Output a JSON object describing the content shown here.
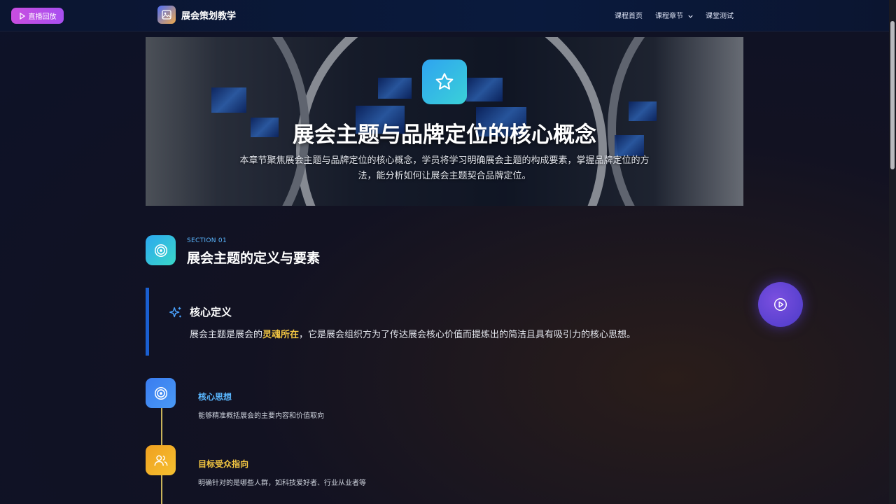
{
  "topbar": {
    "live_label": "直播回放",
    "brand_title": "展会策划教学",
    "nav": {
      "home": "课程首页",
      "chapters": "课程章节",
      "quiz": "课堂测试"
    }
  },
  "hero": {
    "icon": "star-icon",
    "title": "展会主题与品牌定位的核心概念",
    "description": "本章节聚焦展会主题与品牌定位的核心概念，学员将学习明确展会主题的构成要素，掌握品牌定位的方法，能分析如何让展会主题契合品牌定位。"
  },
  "section": {
    "kicker": "SECTION 01",
    "title": "展会主题的定义与要素",
    "icon": "target-icon"
  },
  "definition": {
    "title": "核心定义",
    "text_before": "展会主题是展会的",
    "highlight": "灵魂所在",
    "text_after": "，它是展会组织方为了传达展会核心价值而提炼出的简洁且具有吸引力的核心思想。",
    "icon": "sparkle-icon"
  },
  "timeline": [
    {
      "title": "核心思想",
      "desc": "能够精准概括展会的主要内容和价值取向",
      "icon": "target-icon",
      "color": "#5ab7ff"
    },
    {
      "title": "目标受众指向",
      "desc": "明确针对的是哪些人群，如科技爱好者、行业从业者等",
      "icon": "users-icon",
      "color": "#f5c842"
    }
  ],
  "colors": {
    "accent_blue": "#1a5fd1",
    "highlight_yellow": "#f5c842",
    "live_purple": "#c94de0"
  }
}
